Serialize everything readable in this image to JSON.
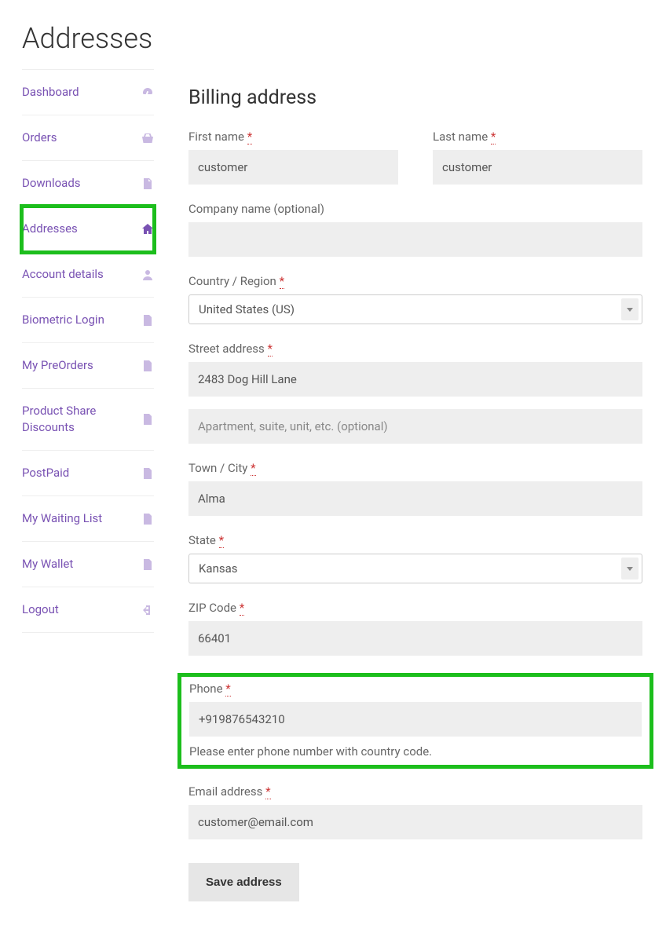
{
  "page_title": "Addresses",
  "sidebar": {
    "items": [
      {
        "label": "Dashboard",
        "icon": "dashboard-icon"
      },
      {
        "label": "Orders",
        "icon": "basket-icon"
      },
      {
        "label": "Downloads",
        "icon": "file-icon"
      },
      {
        "label": "Addresses",
        "icon": "home-icon",
        "active": true
      },
      {
        "label": "Account details",
        "icon": "user-icon"
      },
      {
        "label": "Biometric Login",
        "icon": "file-icon"
      },
      {
        "label": "My PreOrders",
        "icon": "file-icon"
      },
      {
        "label": "Product Share Discounts",
        "icon": "file-icon"
      },
      {
        "label": "PostPaid",
        "icon": "file-icon"
      },
      {
        "label": "My Waiting List",
        "icon": "file-icon"
      },
      {
        "label": "My Wallet",
        "icon": "file-icon"
      },
      {
        "label": "Logout",
        "icon": "logout-icon"
      }
    ]
  },
  "form": {
    "title": "Billing address",
    "first_name": {
      "label": "First name",
      "required": "*",
      "value": "customer"
    },
    "last_name": {
      "label": "Last name",
      "required": "*",
      "value": "customer"
    },
    "company": {
      "label": "Company name (optional)",
      "value": ""
    },
    "country": {
      "label": "Country / Region",
      "required": "*",
      "value": "United States (US)"
    },
    "street1": {
      "label": "Street address",
      "required": "*",
      "value": "2483 Dog Hill Lane"
    },
    "street2": {
      "placeholder": "Apartment, suite, unit, etc. (optional)",
      "value": ""
    },
    "city": {
      "label": "Town / City",
      "required": "*",
      "value": "Alma"
    },
    "state": {
      "label": "State",
      "required": "*",
      "value": "Kansas"
    },
    "zip": {
      "label": "ZIP Code",
      "required": "*",
      "value": "66401"
    },
    "phone": {
      "label": "Phone",
      "required": "*",
      "value": "+919876543210",
      "help": "Please enter phone number with country code."
    },
    "email": {
      "label": "Email address",
      "required": "*",
      "value": "customer@email.com"
    },
    "save_label": "Save address"
  }
}
